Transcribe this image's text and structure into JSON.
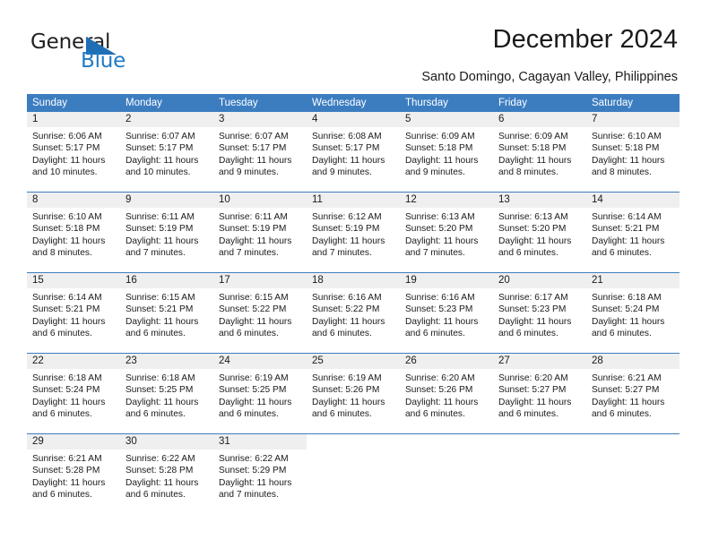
{
  "brand": {
    "name_part1": "General",
    "name_part2": "Blue",
    "accent_color": "#1f7ac4",
    "triangle_icon": "triangle-icon"
  },
  "header": {
    "title": "December 2024",
    "subtitle": "Santo Domingo, Cagayan Valley, Philippines"
  },
  "calendar": {
    "header_bg": "#3c7dc0",
    "day_band_bg": "#efefef",
    "weekdays": [
      "Sunday",
      "Monday",
      "Tuesday",
      "Wednesday",
      "Thursday",
      "Friday",
      "Saturday"
    ],
    "weeks": [
      [
        {
          "day": "1",
          "sunrise": "Sunrise: 6:06 AM",
          "sunset": "Sunset: 5:17 PM",
          "daylight1": "Daylight: 11 hours",
          "daylight2": "and 10 minutes."
        },
        {
          "day": "2",
          "sunrise": "Sunrise: 6:07 AM",
          "sunset": "Sunset: 5:17 PM",
          "daylight1": "Daylight: 11 hours",
          "daylight2": "and 10 minutes."
        },
        {
          "day": "3",
          "sunrise": "Sunrise: 6:07 AM",
          "sunset": "Sunset: 5:17 PM",
          "daylight1": "Daylight: 11 hours",
          "daylight2": "and 9 minutes."
        },
        {
          "day": "4",
          "sunrise": "Sunrise: 6:08 AM",
          "sunset": "Sunset: 5:17 PM",
          "daylight1": "Daylight: 11 hours",
          "daylight2": "and 9 minutes."
        },
        {
          "day": "5",
          "sunrise": "Sunrise: 6:09 AM",
          "sunset": "Sunset: 5:18 PM",
          "daylight1": "Daylight: 11 hours",
          "daylight2": "and 9 minutes."
        },
        {
          "day": "6",
          "sunrise": "Sunrise: 6:09 AM",
          "sunset": "Sunset: 5:18 PM",
          "daylight1": "Daylight: 11 hours",
          "daylight2": "and 8 minutes."
        },
        {
          "day": "7",
          "sunrise": "Sunrise: 6:10 AM",
          "sunset": "Sunset: 5:18 PM",
          "daylight1": "Daylight: 11 hours",
          "daylight2": "and 8 minutes."
        }
      ],
      [
        {
          "day": "8",
          "sunrise": "Sunrise: 6:10 AM",
          "sunset": "Sunset: 5:18 PM",
          "daylight1": "Daylight: 11 hours",
          "daylight2": "and 8 minutes."
        },
        {
          "day": "9",
          "sunrise": "Sunrise: 6:11 AM",
          "sunset": "Sunset: 5:19 PM",
          "daylight1": "Daylight: 11 hours",
          "daylight2": "and 7 minutes."
        },
        {
          "day": "10",
          "sunrise": "Sunrise: 6:11 AM",
          "sunset": "Sunset: 5:19 PM",
          "daylight1": "Daylight: 11 hours",
          "daylight2": "and 7 minutes."
        },
        {
          "day": "11",
          "sunrise": "Sunrise: 6:12 AM",
          "sunset": "Sunset: 5:19 PM",
          "daylight1": "Daylight: 11 hours",
          "daylight2": "and 7 minutes."
        },
        {
          "day": "12",
          "sunrise": "Sunrise: 6:13 AM",
          "sunset": "Sunset: 5:20 PM",
          "daylight1": "Daylight: 11 hours",
          "daylight2": "and 7 minutes."
        },
        {
          "day": "13",
          "sunrise": "Sunrise: 6:13 AM",
          "sunset": "Sunset: 5:20 PM",
          "daylight1": "Daylight: 11 hours",
          "daylight2": "and 6 minutes."
        },
        {
          "day": "14",
          "sunrise": "Sunrise: 6:14 AM",
          "sunset": "Sunset: 5:21 PM",
          "daylight1": "Daylight: 11 hours",
          "daylight2": "and 6 minutes."
        }
      ],
      [
        {
          "day": "15",
          "sunrise": "Sunrise: 6:14 AM",
          "sunset": "Sunset: 5:21 PM",
          "daylight1": "Daylight: 11 hours",
          "daylight2": "and 6 minutes."
        },
        {
          "day": "16",
          "sunrise": "Sunrise: 6:15 AM",
          "sunset": "Sunset: 5:21 PM",
          "daylight1": "Daylight: 11 hours",
          "daylight2": "and 6 minutes."
        },
        {
          "day": "17",
          "sunrise": "Sunrise: 6:15 AM",
          "sunset": "Sunset: 5:22 PM",
          "daylight1": "Daylight: 11 hours",
          "daylight2": "and 6 minutes."
        },
        {
          "day": "18",
          "sunrise": "Sunrise: 6:16 AM",
          "sunset": "Sunset: 5:22 PM",
          "daylight1": "Daylight: 11 hours",
          "daylight2": "and 6 minutes."
        },
        {
          "day": "19",
          "sunrise": "Sunrise: 6:16 AM",
          "sunset": "Sunset: 5:23 PM",
          "daylight1": "Daylight: 11 hours",
          "daylight2": "and 6 minutes."
        },
        {
          "day": "20",
          "sunrise": "Sunrise: 6:17 AM",
          "sunset": "Sunset: 5:23 PM",
          "daylight1": "Daylight: 11 hours",
          "daylight2": "and 6 minutes."
        },
        {
          "day": "21",
          "sunrise": "Sunrise: 6:18 AM",
          "sunset": "Sunset: 5:24 PM",
          "daylight1": "Daylight: 11 hours",
          "daylight2": "and 6 minutes."
        }
      ],
      [
        {
          "day": "22",
          "sunrise": "Sunrise: 6:18 AM",
          "sunset": "Sunset: 5:24 PM",
          "daylight1": "Daylight: 11 hours",
          "daylight2": "and 6 minutes."
        },
        {
          "day": "23",
          "sunrise": "Sunrise: 6:18 AM",
          "sunset": "Sunset: 5:25 PM",
          "daylight1": "Daylight: 11 hours",
          "daylight2": "and 6 minutes."
        },
        {
          "day": "24",
          "sunrise": "Sunrise: 6:19 AM",
          "sunset": "Sunset: 5:25 PM",
          "daylight1": "Daylight: 11 hours",
          "daylight2": "and 6 minutes."
        },
        {
          "day": "25",
          "sunrise": "Sunrise: 6:19 AM",
          "sunset": "Sunset: 5:26 PM",
          "daylight1": "Daylight: 11 hours",
          "daylight2": "and 6 minutes."
        },
        {
          "day": "26",
          "sunrise": "Sunrise: 6:20 AM",
          "sunset": "Sunset: 5:26 PM",
          "daylight1": "Daylight: 11 hours",
          "daylight2": "and 6 minutes."
        },
        {
          "day": "27",
          "sunrise": "Sunrise: 6:20 AM",
          "sunset": "Sunset: 5:27 PM",
          "daylight1": "Daylight: 11 hours",
          "daylight2": "and 6 minutes."
        },
        {
          "day": "28",
          "sunrise": "Sunrise: 6:21 AM",
          "sunset": "Sunset: 5:27 PM",
          "daylight1": "Daylight: 11 hours",
          "daylight2": "and 6 minutes."
        }
      ],
      [
        {
          "day": "29",
          "sunrise": "Sunrise: 6:21 AM",
          "sunset": "Sunset: 5:28 PM",
          "daylight1": "Daylight: 11 hours",
          "daylight2": "and 6 minutes."
        },
        {
          "day": "30",
          "sunrise": "Sunrise: 6:22 AM",
          "sunset": "Sunset: 5:28 PM",
          "daylight1": "Daylight: 11 hours",
          "daylight2": "and 6 minutes."
        },
        {
          "day": "31",
          "sunrise": "Sunrise: 6:22 AM",
          "sunset": "Sunset: 5:29 PM",
          "daylight1": "Daylight: 11 hours",
          "daylight2": "and 7 minutes."
        },
        {
          "day": "",
          "sunrise": "",
          "sunset": "",
          "daylight1": "",
          "daylight2": ""
        },
        {
          "day": "",
          "sunrise": "",
          "sunset": "",
          "daylight1": "",
          "daylight2": ""
        },
        {
          "day": "",
          "sunrise": "",
          "sunset": "",
          "daylight1": "",
          "daylight2": ""
        },
        {
          "day": "",
          "sunrise": "",
          "sunset": "",
          "daylight1": "",
          "daylight2": ""
        }
      ]
    ]
  }
}
